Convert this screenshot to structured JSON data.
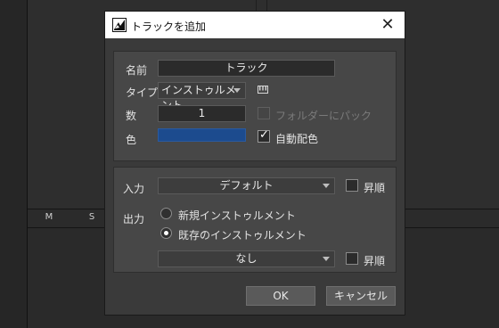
{
  "background": {
    "ms_labels": [
      "M",
      "S"
    ]
  },
  "dialog": {
    "title": "トラックを追加",
    "close_glyph": "✕",
    "name_label": "名前",
    "name_value": "トラック",
    "type_label": "タイプ",
    "type_value": "インストゥルメント",
    "type_icon": "keyboard-icon",
    "count_label": "数",
    "count_value": "1",
    "folder_label": "フォルダーにパック",
    "color_label": "色",
    "color_value": "#1c4b8e",
    "auto_color_label": "自動配色",
    "input_label": "入力",
    "input_value": "デフォルト",
    "input_sort_label": "昇順",
    "output_label": "出力",
    "output_new_label": "新規インストゥルメント",
    "output_existing_label": "既存のインストゥルメント",
    "output_value": "なし",
    "output_sort_label": "昇順",
    "ok_label": "OK",
    "cancel_label": "キャンセル"
  }
}
